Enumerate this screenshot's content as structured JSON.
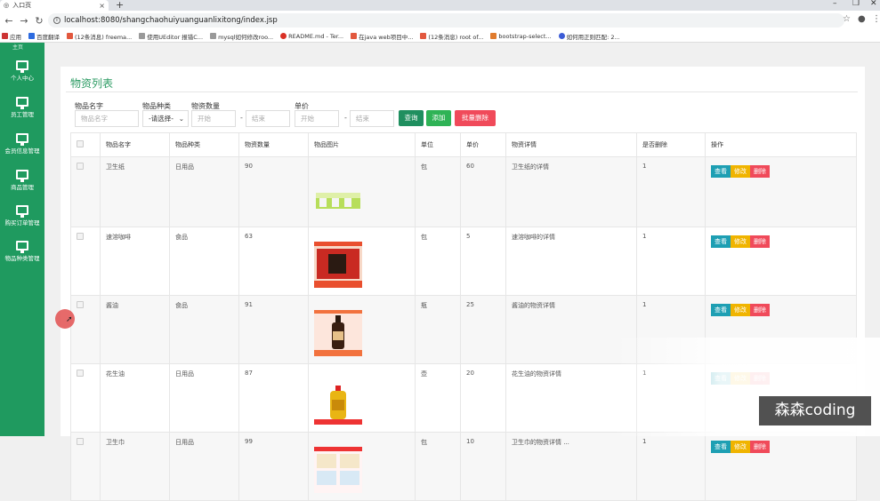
{
  "browser": {
    "tab_title": "入口页",
    "url": "localhost:8080/shangchaohuiyuanguanlixitong/index.jsp",
    "bookmarks": [
      {
        "label": "应用",
        "color": "#444"
      },
      {
        "label": "百度翻译",
        "color": "#2d6be0"
      },
      {
        "label": "(12条消息) freema...",
        "color": "#e2583e"
      },
      {
        "label": "使用UEditor 报错C...",
        "color": "#777"
      },
      {
        "label": "mysql如何修改roo...",
        "color": "#777"
      },
      {
        "label": "README.md - Ter...",
        "color": "#d93025"
      },
      {
        "label": "在java web项目中...",
        "color": "#e2583e"
      },
      {
        "label": "(12条消息) root of...",
        "color": "#e2583e"
      },
      {
        "label": "bootstrap-select...",
        "color": "#e07b2d"
      },
      {
        "label": "如何用正则匹配: 2...",
        "color": "#3b5bd6"
      }
    ]
  },
  "sidebar": {
    "top_label": "主页",
    "items": [
      {
        "label": "个人中心"
      },
      {
        "label": "员工管理"
      },
      {
        "label": "会员信息管理"
      },
      {
        "label": "商品管理"
      },
      {
        "label": "购买订单管理"
      },
      {
        "label": "物品种类管理"
      }
    ]
  },
  "page": {
    "title": "物资列表",
    "filters": {
      "name_label": "物品名字",
      "name_placeholder": "物品名字",
      "type_label": "物品种类",
      "type_value": "-请选择-",
      "qty_label": "物资数量",
      "qty_start": "开始",
      "qty_end": "结束",
      "price_label": "单价",
      "price_start": "开始",
      "price_end": "结束",
      "range_sep": "-"
    },
    "buttons": {
      "search": "查询",
      "add": "添加",
      "batch_delete": "批量删除"
    },
    "colors": {
      "search": "#1f8f5f",
      "add": "#2fb356",
      "batch_delete": "#f04a5a",
      "sidebar": "#1f9a5f"
    }
  },
  "table": {
    "headers": [
      "",
      "物品名字",
      "物品种类",
      "物资数量",
      "物品图片",
      "单位",
      "单价",
      "物资详情",
      "是否删除",
      "操作"
    ],
    "actions": {
      "view": "查看",
      "edit": "修改",
      "delete": "删除"
    },
    "rows": [
      {
        "name": "卫生纸",
        "type": "日用品",
        "qty": "90",
        "image": "tissue-pack-image",
        "unit": "包",
        "price": "60",
        "detail": "卫生纸的详情",
        "deleted": "1"
      },
      {
        "name": "速溶咖啡",
        "type": "食品",
        "qty": "63",
        "image": "coffee-box-image",
        "unit": "包",
        "price": "5",
        "detail": "速溶咖啡的详情",
        "deleted": "1"
      },
      {
        "name": "酱油",
        "type": "食品",
        "qty": "91",
        "image": "soy-sauce-bottle-image",
        "unit": "瓶",
        "price": "25",
        "detail": "酱油的物资详情",
        "deleted": "1"
      },
      {
        "name": "花生油",
        "type": "日用品",
        "qty": "87",
        "image": "peanut-oil-bottle-image",
        "unit": "壶",
        "price": "20",
        "detail": "花生油的物资详情",
        "deleted": "1"
      },
      {
        "name": "卫生巾",
        "type": "日用品",
        "qty": "99",
        "image": "sanitary-pad-box-image",
        "unit": "包",
        "price": "10",
        "detail": "卫生巾的物资详情 ...",
        "deleted": "1"
      }
    ]
  },
  "watermark": "森森coding"
}
